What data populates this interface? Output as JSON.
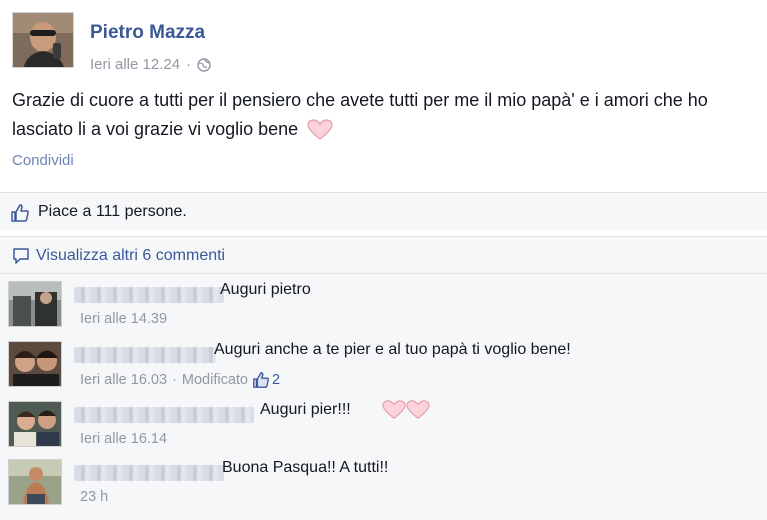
{
  "post": {
    "author": "Pietro Mazza",
    "timestamp": "Ieri alle 12.24",
    "separator": "·",
    "privacy_icon": "globe-icon",
    "text": "Grazie di cuore a tutti per il pensiero che avete tutti per me il mio papà' e i amori che ho lasciato li a voi grazie vi voglio bene",
    "share_label": "Condividi",
    "likes_text": "Piace a 111 persone.",
    "more_comments": "Visualizza altri 6 commenti"
  },
  "comments": [
    {
      "text": "Auguri pietro",
      "time": "Ieri alle 14.39"
    },
    {
      "text": "Auguri anche a te pier e al tuo papà ti voglio bene!",
      "time": "Ieri alle 16.03",
      "edited": "Modificato",
      "likes": "2"
    },
    {
      "text": "Auguri pier!!!",
      "time": "Ieri alle 16.14",
      "hearts": 2
    },
    {
      "text": "Buona Pasqua!! A tutti!!",
      "time": "23 h"
    }
  ],
  "colors": {
    "link": "#3b5998",
    "meta": "#9197a3",
    "heart": "#f4b6c2",
    "background": "#f6f7f9"
  }
}
